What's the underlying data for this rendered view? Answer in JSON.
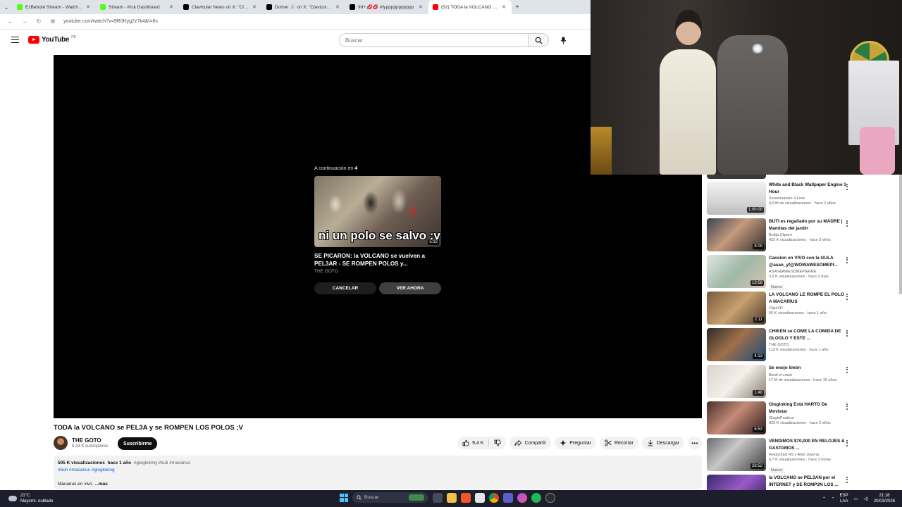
{
  "browser": {
    "tabs": [
      {
        "title": "EzBebote Stream - Watch Live",
        "favicon_color": "#53fc18",
        "active": false
      },
      {
        "title": "Stream - Kick Dashboard",
        "favicon_color": "#53fc18",
        "active": false
      },
      {
        "title": "Clavicular News on X: \"Clavicul",
        "favicon_color": "#000000",
        "active": false
      },
      {
        "title": "Domer 🐰 on X: \"Clavicular ad",
        "favicon_color": "#000000",
        "active": false
      },
      {
        "title": "99+ 💋💋 #fyppppppppppp",
        "favicon_color": "#000000",
        "active": false
      },
      {
        "title": "(52) TODA la VOLCANO se PEL3",
        "favicon_color": "#ff0000",
        "active": true
      }
    ],
    "url": "youtube.com/watch?v=9R0Hyg2z7k4&t=6s"
  },
  "youtube": {
    "logo_text": "YouTube",
    "country_code": "PE",
    "search_placeholder": "Buscar"
  },
  "player": {
    "up_next_label": "A continuación en",
    "countdown": "4",
    "thumb_caption": "ni un polo se salvo :v",
    "duration": "5:32",
    "next_title": "SE PICARON: la VOLCANO se vuelven a PEL3AR - SE ROMPEN POLOS y...",
    "next_channel": "THE GOTO",
    "cancel_label": "CANCELAR",
    "watch_label": "VER AHORA"
  },
  "video": {
    "title": "TODA la VOLCANO se PEL3A y se ROMPEN LOS POLOS ;V",
    "channel": "THE GOTO",
    "subscribers": "5,43 K suscriptores",
    "subscribe_label": "Suscribirme",
    "likes": "9,4 K",
    "share_label": "Compartir",
    "ask_label": "Preguntar",
    "clip_label": "Recortar",
    "download_label": "Descargar",
    "views": "505 K visualizaciones",
    "age": "hace 1 año",
    "tags_line1": "#glogloking #buti #macarius",
    "tags_line2": "#buti #macarius #glogloking",
    "desc_text": "Macarius en vivo",
    "more_label": "...más"
  },
  "recommendations": [
    {
      "title": "White and Black Wallpaper Engine 1 Hour",
      "channel": "Screensavers 4 Free",
      "meta": "4,9 M de visualizaciones · hace 2 años",
      "duration": "1:00:00",
      "badge": "",
      "thumb": "linear-gradient(180deg,#f2f2f2 0%,#d8d8d8 55%,#bdbdbd 100%)"
    },
    {
      "title": "BUTI es regañado por su MADRE | Mamitas del jardín",
      "channel": "Bottja Clipero",
      "meta": "422 K visualizaciones · hace 3 años",
      "duration": "8:09",
      "badge": "",
      "thumb": "linear-gradient(135deg,#3b4350 0%,#c59a7c 45%,#2c2c2c 100%)"
    },
    {
      "title": "Cancion en VIVO con la GULA @asan_yf@WOWAWESOMEPI...",
      "channel": "ASAN&AWESOMEPIERRE",
      "meta": "3,9 K visualizaciones · hace 2 días",
      "duration": "13:58",
      "badge": "Nuevo",
      "thumb": "linear-gradient(135deg,#dfe6e2 0%,#9fb9a8 50%,#d9c3b0 100%)"
    },
    {
      "title": "LA VOLCANO LE ROMPE EL POLO A MACARIUS",
      "channel": "ClipsXD",
      "meta": "60 K visualizaciones · hace 1 año",
      "duration": "2:11",
      "badge": "",
      "thumb": "linear-gradient(135deg,#7a5a3b 0%,#c8a070 50%,#4b3a2a 100%)"
    },
    {
      "title": "CHIKEN se COME LA COMIDA DE GLOGLO Y ESTE ...",
      "channel": "THE GOTO",
      "meta": "113 K visualizaciones · hace 1 año",
      "duration": "4:13",
      "badge": "",
      "thumb": "linear-gradient(135deg,#2d2a28 0%,#a0704a 45%,#1b4a7a 100%)"
    },
    {
      "title": "Se enojo limón",
      "channel": "Bauti el crack",
      "meta": "17 M de visualizaciones · hace 10 años",
      "duration": "1:48",
      "badge": "",
      "thumb": "linear-gradient(135deg,#d9d3cb 0%,#f4f0ea 50%,#8a7d70 100%)"
    },
    {
      "title": "Glogloking Está HARTO De Movistar",
      "channel": "GlogloPardera",
      "meta": "929 K visualizaciones · hace 2 años",
      "duration": "6:53",
      "badge": "",
      "thumb": "linear-gradient(135deg,#4a2f2a 0%,#c58a78 45%,#2b1c1a 100%)"
    },
    {
      "title": "VENDIMOS $70,000 EN RELOJES & GASTAMOS ...",
      "channel": "Restocked HS y Ariel Joyeria",
      "meta": "6,7 K visualizaciones · hace 3 horas",
      "duration": "28:52",
      "badge": "Nuevo",
      "thumb": "linear-gradient(135deg,#6a6a6a 0%,#c8c8c8 40%,#3a3a3a 100%)"
    },
    {
      "title": "la VOLCANO se PEL3AN por el INTERNET y SE ROMP3N LOS ...",
      "channel": "",
      "meta": "",
      "duration": "",
      "badge": "",
      "thumb": "linear-gradient(135deg,#3a2a6a 0%,#9a5ac8 50%,#2a1a4a 100%)"
    }
  ],
  "taskbar": {
    "temperature": "21°C",
    "weather": "Mayorm. nublado",
    "search_placeholder": "Buscar",
    "lang_top": "ESP",
    "lang_bottom": "LAA",
    "time": "21:18",
    "date": "20/03/2026"
  }
}
